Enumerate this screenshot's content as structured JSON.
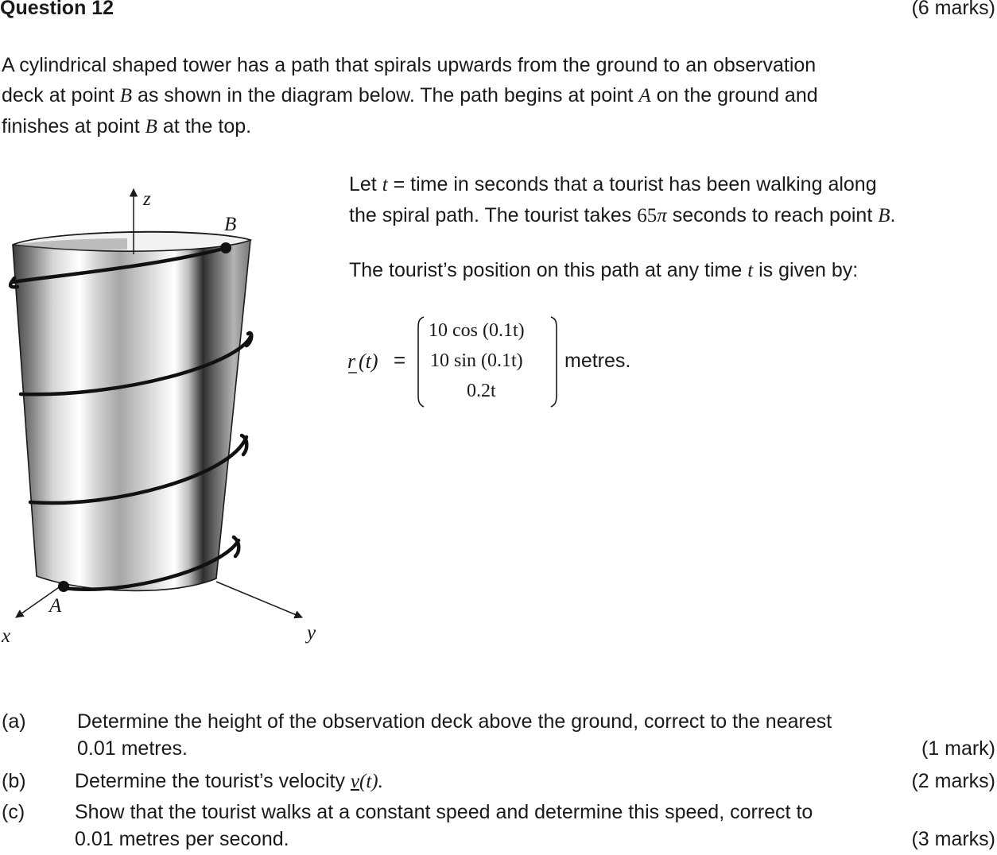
{
  "header": {
    "title": "Question 12",
    "marks": "(6 marks)"
  },
  "intro": {
    "s1": "A cylindrical shaped tower has a path that spirals upwards from the ground to an observation",
    "s2a": "deck at point ",
    "B1": "B",
    "s2b": " as shown in the diagram below. The path begins at point ",
    "A1": "A",
    "s2c": " on the ground and",
    "s3a": "finishes at point ",
    "B2": "B",
    "s3b": " at the top."
  },
  "context": {
    "l1a": "Let ",
    "t1": "t",
    "l1b": " = time in seconds that a tourist has been walking along",
    "l2a": "the spiral path. The tourist takes ",
    "l2num": "65",
    "l2pi": "π",
    "l2b": " seconds to reach point ",
    "B": "B",
    "l2c": "."
  },
  "position": {
    "a": "The tourist’s position on this path at any time ",
    "t": "t",
    "b": " is given by:"
  },
  "vector": {
    "lhs_r": "r",
    "lhs_t": "(t)",
    "eq": "=",
    "row1": "10 cos (0.1t)",
    "row2": "10 sin (0.1t)",
    "row3": "0.2t",
    "unit": "metres."
  },
  "diagram": {
    "axis_z": "z",
    "axis_x": "x",
    "axis_y": "y",
    "point_A": "A",
    "point_B": "B"
  },
  "parts": [
    {
      "label": "(a)",
      "line1": "Determine the height of the observation deck above the ground, correct to the nearest",
      "line2": "0.01 metres.",
      "marks": "(1 mark)"
    },
    {
      "label": "(b)",
      "line1a": "Determine the tourist’s velocity ",
      "v": "v",
      "line1b": "(t).",
      "marks": "(2 marks)"
    },
    {
      "label": "(c)",
      "line1": "Show that the tourist walks at a constant speed and determine this speed, correct to",
      "line2": "0.01 metres per second.",
      "marks": "(3 marks)"
    }
  ]
}
